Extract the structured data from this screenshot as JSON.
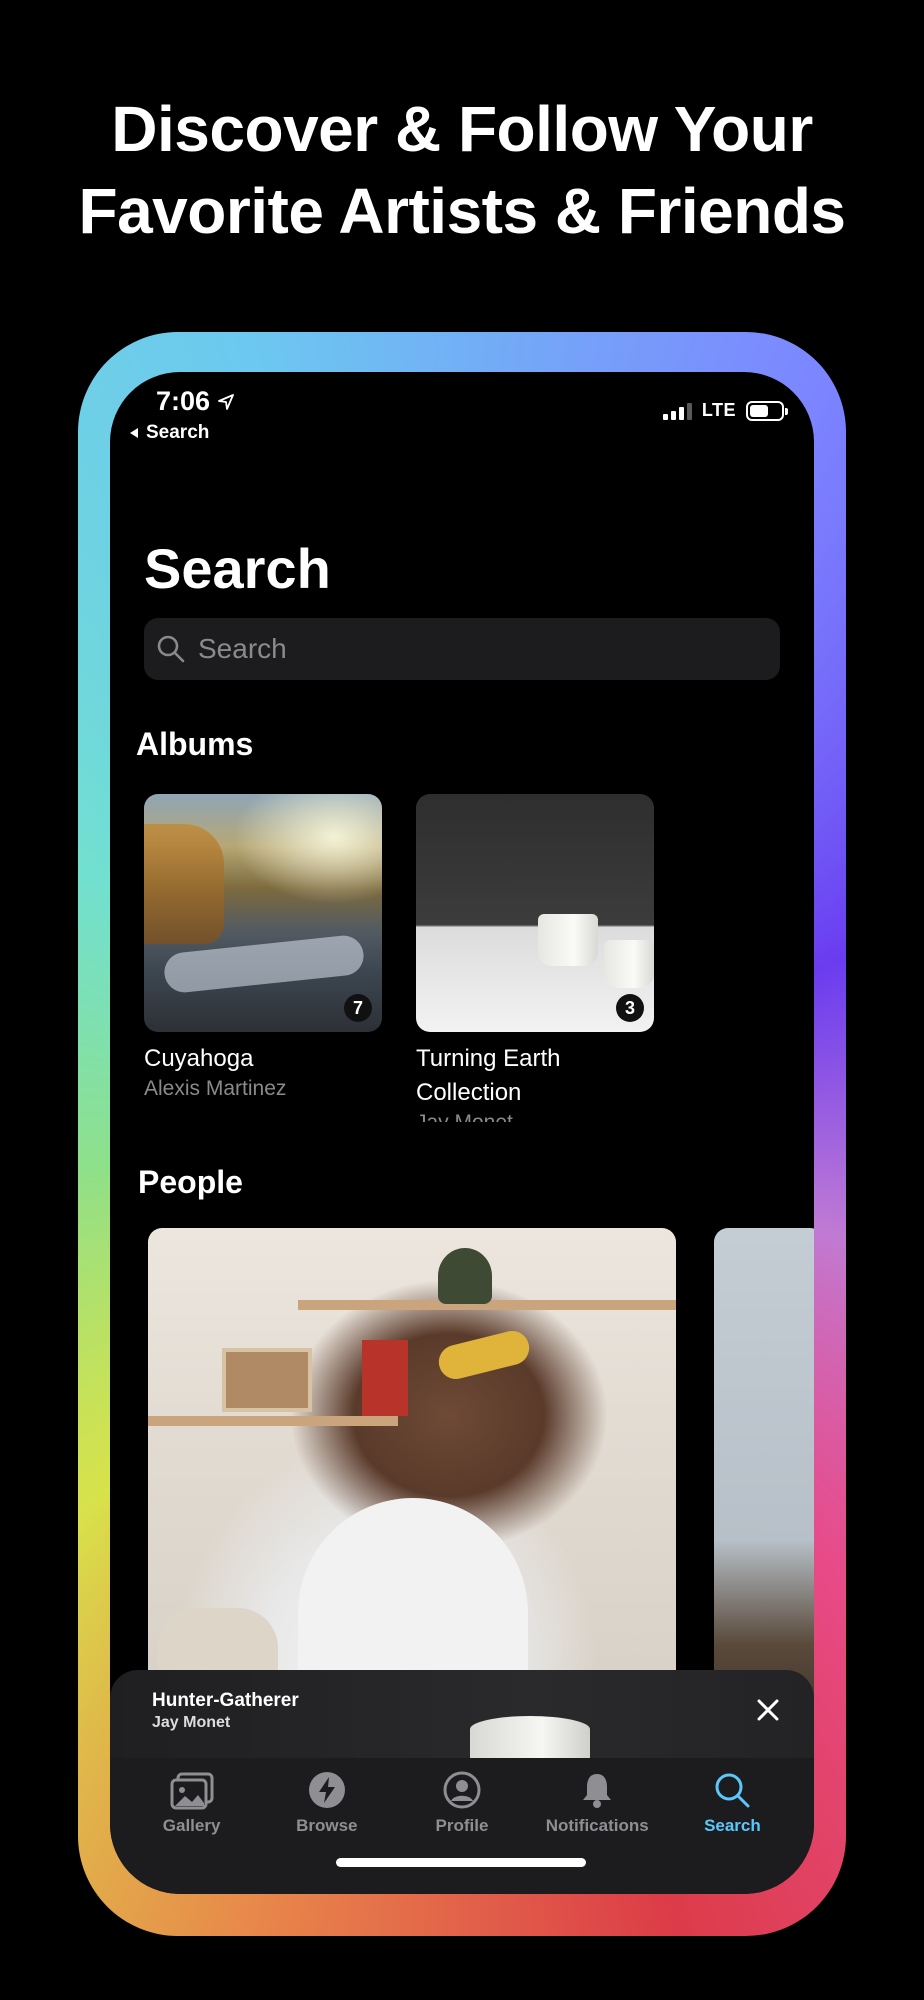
{
  "headline": {
    "line1": "Discover & Follow Your",
    "line2": "Favorite Artists & Friends"
  },
  "status_bar": {
    "time": "7:06",
    "back_label": "Search",
    "network": "LTE"
  },
  "page": {
    "title": "Search"
  },
  "search": {
    "placeholder": "Search",
    "value": ""
  },
  "albums": {
    "heading": "Albums",
    "items": [
      {
        "title": "Cuyahoga",
        "artist": "Alexis Martinez",
        "count": "7"
      },
      {
        "title_line1": "Turning Earth",
        "title_line2": "Collection",
        "artist": "Jay Monet",
        "count": "3"
      }
    ]
  },
  "people": {
    "heading": "People"
  },
  "mini_player": {
    "title": "Hunter-Gatherer",
    "artist": "Jay Monet"
  },
  "tabs": [
    {
      "label": "Gallery",
      "icon": "gallery-icon",
      "active": false
    },
    {
      "label": "Browse",
      "icon": "bolt-icon",
      "active": false
    },
    {
      "label": "Profile",
      "icon": "person-icon",
      "active": false
    },
    {
      "label": "Notifications",
      "icon": "bell-icon",
      "active": false
    },
    {
      "label": "Search",
      "icon": "search-icon",
      "active": true
    }
  ],
  "colors": {
    "active_tab": "#5ac8fa",
    "inactive_tab": "#8e8e93",
    "surface": "#1c1c1e"
  }
}
